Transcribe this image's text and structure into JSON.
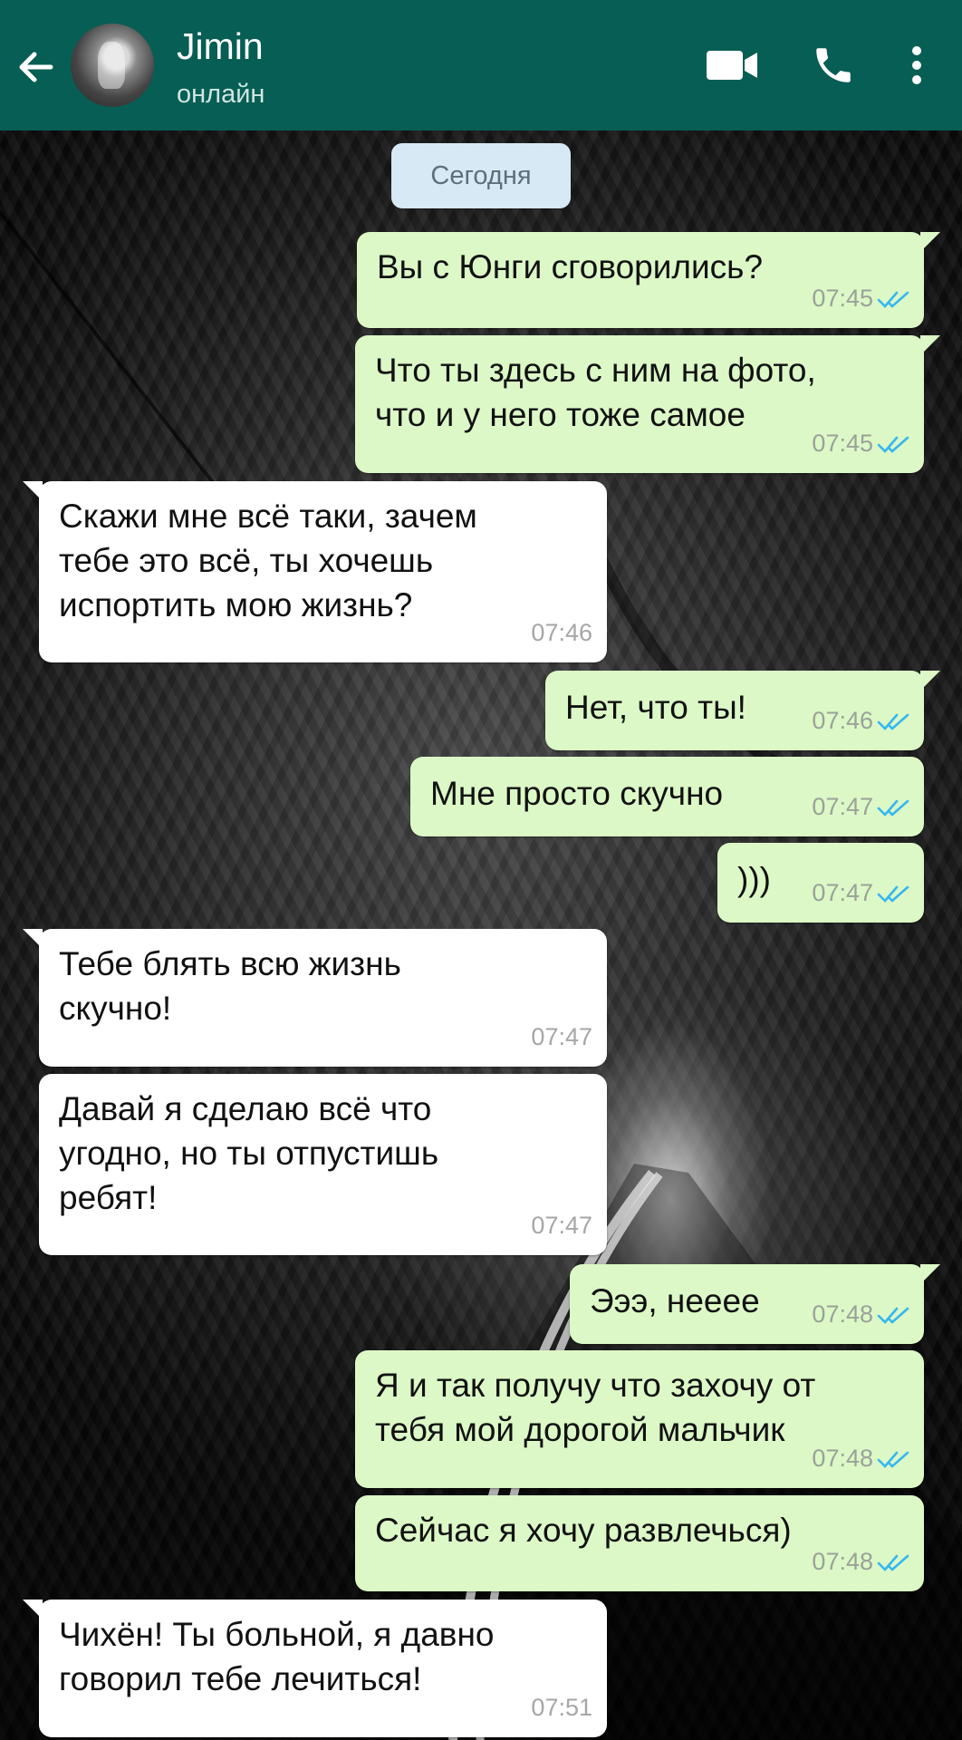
{
  "header": {
    "contact_name": "Jimin",
    "status": "онлайн",
    "colors": {
      "bar": "#075e54"
    },
    "icons": [
      "back-arrow-icon",
      "video-camera-icon",
      "phone-icon",
      "more-vert-icon"
    ]
  },
  "date_label": "Сегодня",
  "colors": {
    "outgoing": "#dcf8c6",
    "incoming": "#ffffff",
    "read_ticks": "#34b7f1"
  },
  "messages": [
    {
      "dir": "out",
      "lines": [
        "Вы с Юнги сговорились?"
      ],
      "time": "07:45",
      "read": true
    },
    {
      "dir": "out",
      "lines": [
        "Что ты здесь с ним на фото,",
        "что и у него тоже самое"
      ],
      "time": "07:45",
      "read": true
    },
    {
      "dir": "in",
      "lines": [
        "Скажи мне всё таки, зачем",
        "тебе это всё, ты хочешь",
        "испортить мою жизнь?"
      ],
      "time": "07:46"
    },
    {
      "dir": "out",
      "lines": [
        "Нет, что ты!"
      ],
      "time": "07:46",
      "read": true
    },
    {
      "dir": "out",
      "lines": [
        "Мне просто скучно"
      ],
      "time": "07:47",
      "read": true
    },
    {
      "dir": "out",
      "lines": [
        ")))"
      ],
      "time": "07:47",
      "read": true
    },
    {
      "dir": "in",
      "lines": [
        "Тебе блять всю жизнь",
        "скучно!"
      ],
      "time": "07:47"
    },
    {
      "dir": "in",
      "lines": [
        "Давай я сделаю всё что",
        "угодно, но ты отпустишь",
        "ребят!"
      ],
      "time": "07:47"
    },
    {
      "dir": "out",
      "lines": [
        "Эээ, нееее"
      ],
      "time": "07:48",
      "read": true
    },
    {
      "dir": "out",
      "lines": [
        "Я и так получу что захочу от",
        "тебя мой дорогой мальчик"
      ],
      "time": "07:48",
      "read": true
    },
    {
      "dir": "out",
      "lines": [
        "Сейчас я хочу развлечься)"
      ],
      "time": "07:48",
      "read": true
    },
    {
      "dir": "in",
      "lines": [
        "Чихён! Ты больной, я давно",
        "говорил тебе лечиться!"
      ],
      "time": "07:51"
    }
  ]
}
